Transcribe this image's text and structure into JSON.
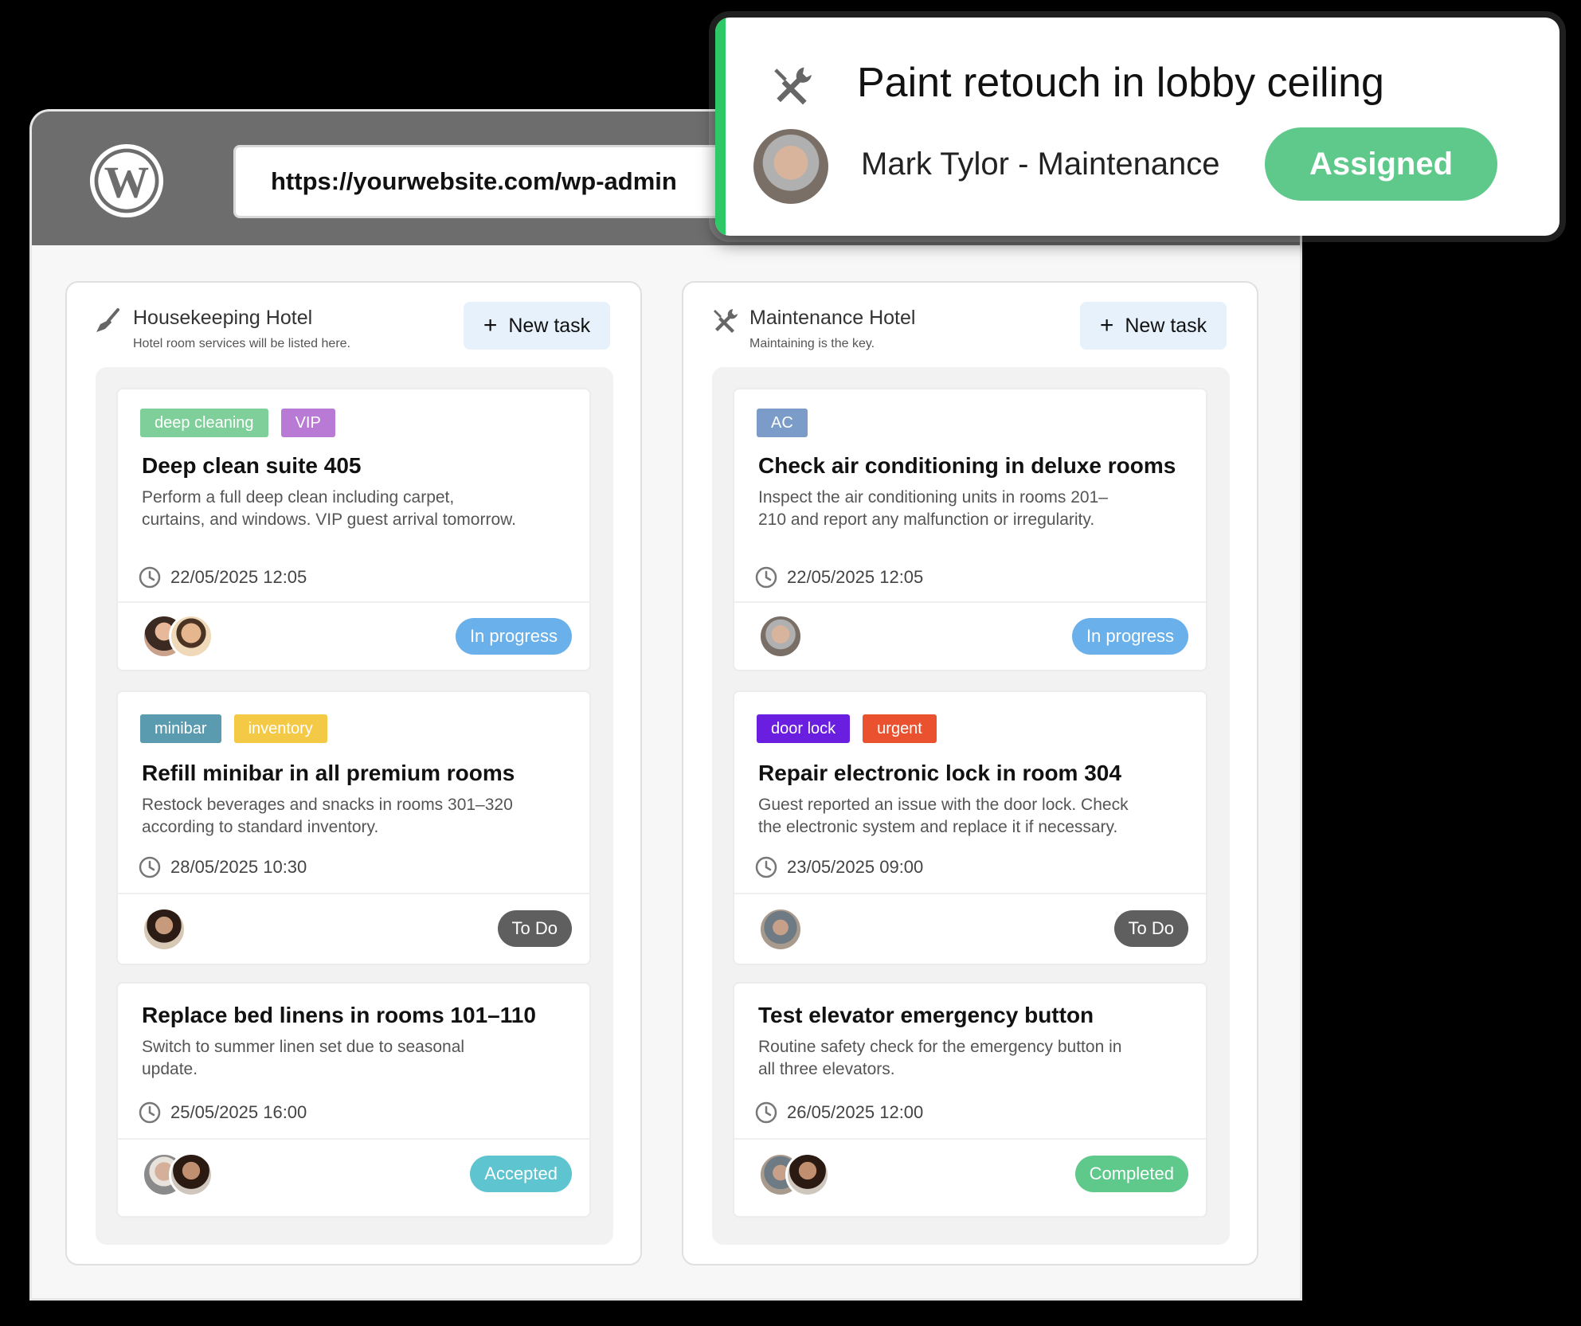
{
  "browser": {
    "url": "https://yourwebsite.com/wp-admin",
    "logo_icon": "wordpress-logo-icon"
  },
  "popup": {
    "icon": "tools-icon",
    "title": "Paint retouch in lobby ceiling",
    "person": "Mark Tylor - Maintenance",
    "status": "Assigned",
    "accent_color": "#2ec866",
    "status_color": "#5ec98b"
  },
  "columns": [
    {
      "icon": "broom-icon",
      "title": "Housekeeping Hotel",
      "subtitle": "Hotel room services will be listed here.",
      "new_task_label": "New task",
      "cards": [
        {
          "tags": [
            {
              "label": "deep cleaning",
              "color": "#7fcf9a"
            },
            {
              "label": "VIP",
              "color": "#b97ad6"
            }
          ],
          "title": "Deep clean suite 405",
          "description": "Perform a full deep clean including carpet, curtains, and windows. VIP guest arrival tomorrow.",
          "date": "22/05/2025 12:05",
          "status": "In progress",
          "status_bg": "#6ab0ea",
          "status_fg": "#ffffff"
        },
        {
          "tags": [
            {
              "label": "minibar",
              "color": "#5a9bb0"
            },
            {
              "label": "inventory",
              "color": "#f3c945"
            }
          ],
          "title": "Refill minibar in all premium rooms",
          "description": "Restock beverages and snacks in rooms 301–320 according to standard inventory.",
          "date": "28/05/2025 10:30",
          "status": "To Do",
          "status_bg": "#5f5f5f",
          "status_fg": "#ffffff"
        },
        {
          "tags": [],
          "title": "Replace bed linens in rooms 101–110",
          "description": "Switch to summer linen set due to seasonal update.",
          "date": "25/05/2025 16:00",
          "status": "Accepted",
          "status_bg": "#5ec4cf",
          "status_fg": "#ffffff"
        }
      ]
    },
    {
      "icon": "tools-icon",
      "title": "Maintenance Hotel",
      "subtitle": "Maintaining is the key.",
      "new_task_label": "New task",
      "cards": [
        {
          "tags": [
            {
              "label": "AC",
              "color": "#7b9cc9"
            }
          ],
          "title": "Check air conditioning in deluxe rooms",
          "description": "Inspect the air conditioning units in rooms 201–210 and report any malfunction or irregularity.",
          "date": "22/05/2025 12:05",
          "status": "In progress",
          "status_bg": "#6ab0ea",
          "status_fg": "#ffffff"
        },
        {
          "tags": [
            {
              "label": "door lock",
              "color": "#6a1fe0"
            },
            {
              "label": "urgent",
              "color": "#e9512f"
            }
          ],
          "title": "Repair electronic lock in room 304",
          "description": "Guest reported an issue with the door lock. Check the electronic system and replace it if necessary.",
          "date": "23/05/2025 09:00",
          "status": "To Do",
          "status_bg": "#5f5f5f",
          "status_fg": "#ffffff"
        },
        {
          "tags": [],
          "title": "Test elevator emergency button",
          "description": "Routine safety check for the emergency button in all three elevators.",
          "date": "26/05/2025 12:00",
          "status": "Completed",
          "status_bg": "#5ec98b",
          "status_fg": "#ffffff"
        }
      ]
    }
  ]
}
